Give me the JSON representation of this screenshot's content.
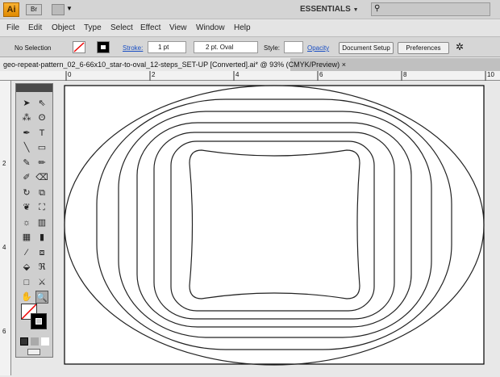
{
  "appbar": {
    "logo": "Ai",
    "bridge": "Br",
    "workspace": "ESSENTIALS",
    "workspace_arrow": "▼",
    "search_placeholder": ""
  },
  "menu": [
    "File",
    "Edit",
    "Object",
    "Type",
    "Select",
    "Effect",
    "View",
    "Window",
    "Help"
  ],
  "control": {
    "selection": "No Selection",
    "stroke_label": "Stroke:",
    "stroke_weight": "1 pt",
    "brush": "2 pt. Oval",
    "style_label": "Style:",
    "opacity_label": "Opacity",
    "document_setup": "Document Setup",
    "preferences": "Preferences"
  },
  "document": {
    "tab_title": "geo-repeat-pattern_02_6-66x10_star-to-oval_12-steps_SET-UP [Converted].ai* @ 93% (CMYK/Preview)",
    "close": "×"
  },
  "rulers": {
    "horizontal": [
      "0",
      "2",
      "4",
      "6",
      "8",
      "10"
    ],
    "vertical": [
      "2",
      "4",
      "6"
    ]
  },
  "tools": [
    "selection",
    "direct-selection",
    "magic-wand",
    "lasso",
    "pen",
    "type",
    "line",
    "rectangle",
    "paintbrush",
    "pencil",
    "blob-brush",
    "eraser",
    "rotate",
    "scale",
    "warp",
    "free-transform",
    "symbol-sprayer",
    "column-graph",
    "mesh",
    "gradient",
    "eyedropper",
    "blend",
    "live-paint",
    "live-paint-selection",
    "artboard",
    "slice",
    "hand",
    "zoom"
  ],
  "colors": {
    "stroke": "#000000",
    "fill": "none",
    "accent": "#f0a020"
  }
}
